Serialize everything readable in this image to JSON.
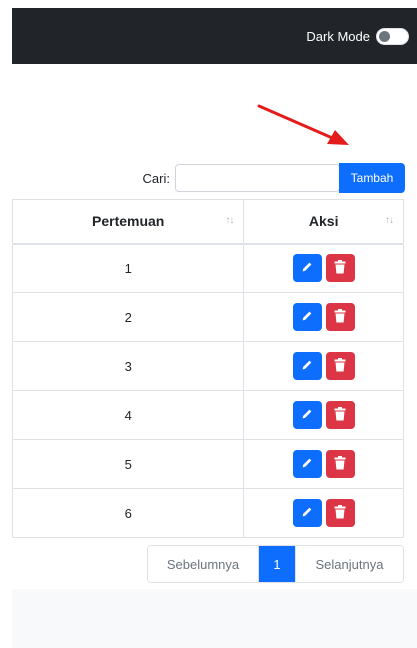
{
  "navbar": {
    "dark_mode_label": "Dark Mode",
    "dark_mode_on": false,
    "background": "#212529"
  },
  "search": {
    "label": "Cari:",
    "value": "",
    "placeholder": ""
  },
  "add_button": {
    "label": "Tambah",
    "color": "#0d6efd"
  },
  "annotation_arrow": {
    "color": "#e41c1c"
  },
  "table": {
    "columns": [
      "Pertemuan",
      "Aksi"
    ],
    "sort_icon": "sort-arrows-icon",
    "rows": [
      {
        "pertemuan": "1"
      },
      {
        "pertemuan": "2"
      },
      {
        "pertemuan": "3"
      },
      {
        "pertemuan": "4"
      },
      {
        "pertemuan": "5"
      },
      {
        "pertemuan": "6"
      }
    ],
    "edit_icon": "pencil-icon",
    "delete_icon": "trash-icon",
    "edit_color": "#0d6efd",
    "delete_color": "#dc3545"
  },
  "pagination": {
    "prev": "Sebelumnya",
    "current": "1",
    "next": "Selanjutnya"
  }
}
